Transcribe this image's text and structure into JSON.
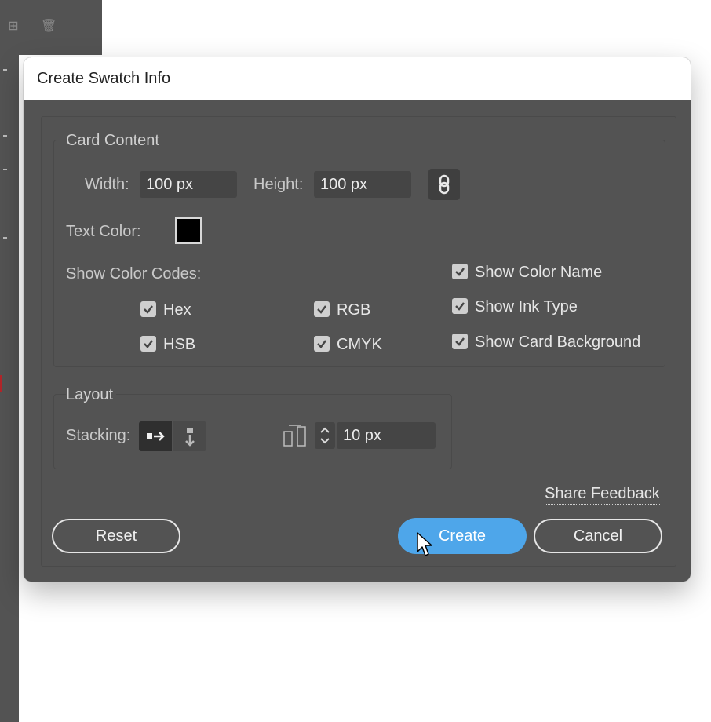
{
  "dialog": {
    "title": "Create Swatch Info"
  },
  "card_content": {
    "title": "Card Content",
    "width_label": "Width:",
    "width_value": "100 px",
    "height_label": "Height:",
    "height_value": "100 px",
    "text_color_label": "Text Color:",
    "text_color": "#000000",
    "show_color_codes_label": "Show Color Codes:",
    "codes": [
      {
        "label": "Hex",
        "checked": true
      },
      {
        "label": "RGB",
        "checked": true
      },
      {
        "label": "HSB",
        "checked": true
      },
      {
        "label": "CMYK",
        "checked": true
      }
    ],
    "options": [
      {
        "label": "Show Color Name",
        "checked": true
      },
      {
        "label": "Show Ink Type",
        "checked": true
      },
      {
        "label": "Show Card Background",
        "checked": true
      }
    ]
  },
  "layout": {
    "title": "Layout",
    "stacking_label": "Stacking:",
    "stacking_selected": "horizontal",
    "spacing_value": "10 px"
  },
  "footer": {
    "share_feedback": "Share Feedback",
    "reset": "Reset",
    "create": "Create",
    "cancel": "Cancel"
  },
  "colors": {
    "dialog_bg": "#535353",
    "accent": "#4ea6ea"
  }
}
